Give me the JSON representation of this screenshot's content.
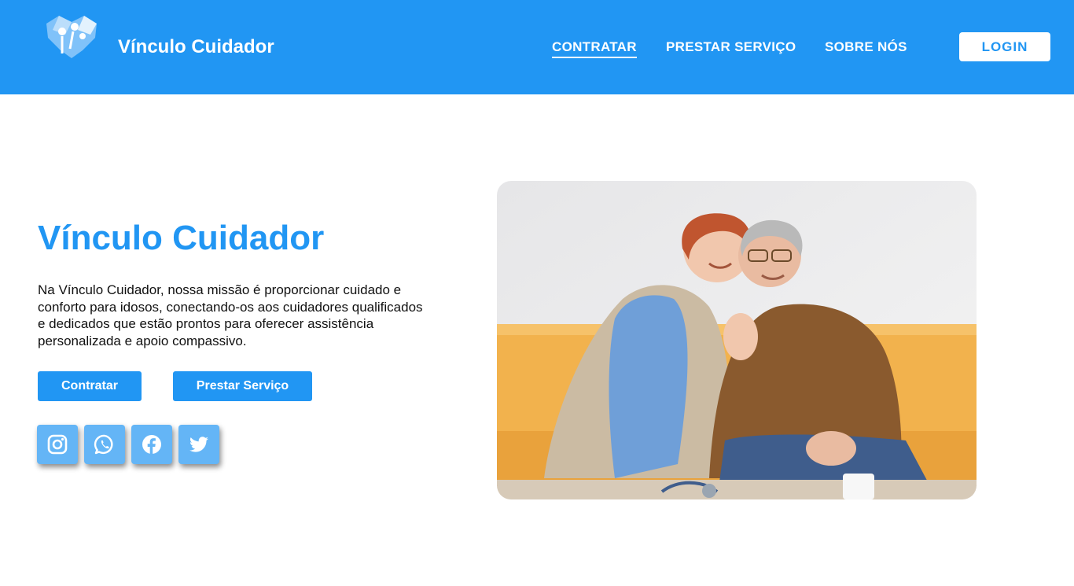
{
  "header": {
    "brand": "Vínculo Cuidador",
    "nav": [
      {
        "label": "CONTRATAR",
        "active": true
      },
      {
        "label": "PRESTAR SERVIÇO",
        "active": false
      },
      {
        "label": "SOBRE NÓS",
        "active": false
      }
    ],
    "login_label": "LOGIN"
  },
  "hero": {
    "title": "Vínculo Cuidador",
    "description": "Na Vínculo Cuidador, nossa missão é proporcionar cuidado e conforto para idosos, conectando-os aos cuidadores qualificados e dedicados que estão prontos para oferecer assistência personalizada e apoio compassivo.",
    "buttons": {
      "hire": "Contratar",
      "provide": "Prestar Serviço"
    },
    "social": [
      "instagram-icon",
      "whatsapp-icon",
      "facebook-icon",
      "twitter-icon"
    ]
  },
  "colors": {
    "primary": "#2196f3",
    "social_bg": "#64b5f6",
    "sofa": "#f2b24d",
    "scrubs": "#6f9fd8",
    "shirt": "#8a5a2e"
  }
}
